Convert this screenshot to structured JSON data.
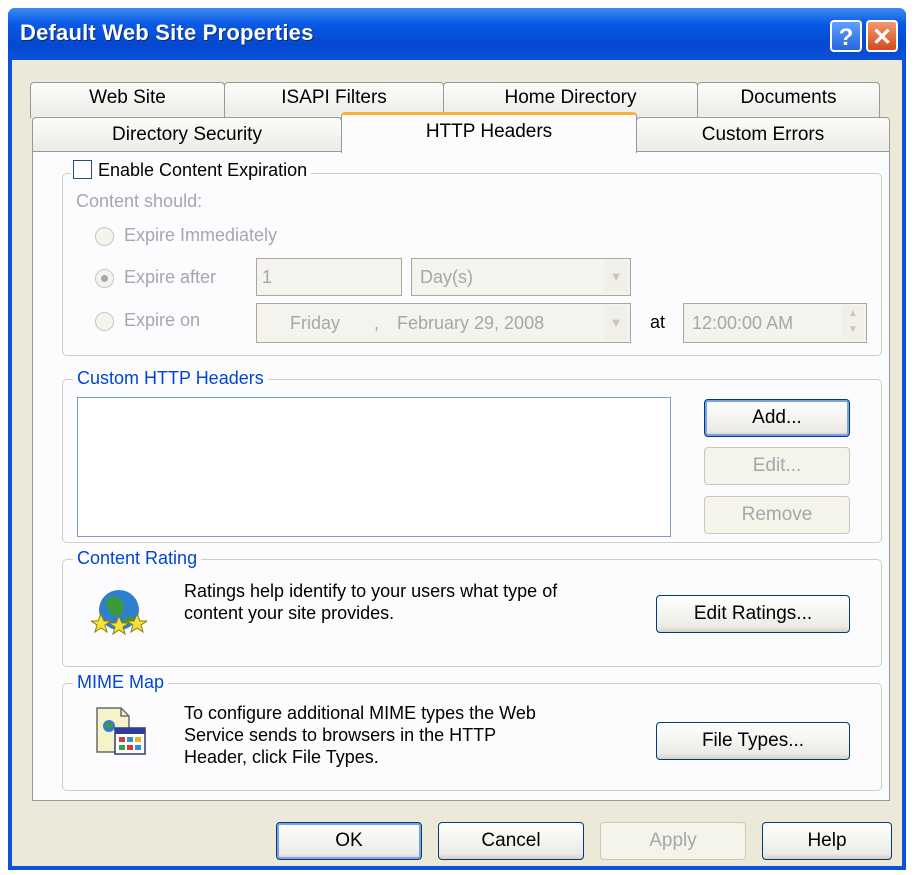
{
  "window": {
    "title": "Default Web Site Properties",
    "help_glyph": "?",
    "close_glyph": "✕"
  },
  "tabs_row1": [
    "Web Site",
    "ISAPI Filters",
    "Home Directory",
    "Documents"
  ],
  "tabs_row2": [
    "Directory Security",
    "HTTP Headers",
    "Custom Errors"
  ],
  "active_tab": "HTTP Headers",
  "expiration": {
    "checkbox_label": "Enable Content Expiration",
    "checked": false,
    "content_should": "Content should:",
    "radio_immediately": "Expire Immediately",
    "radio_after": "Expire after",
    "radio_on": "Expire on",
    "after_value": "1",
    "after_unit": "Day(s)",
    "date_weekday": "Friday",
    "date_sep": ",",
    "date_value": "February  29, 2008",
    "at_label": "at",
    "time_value": "12:00:00 AM"
  },
  "custom_headers": {
    "legend": "Custom HTTP Headers",
    "items": [],
    "add": "Add...",
    "edit": "Edit...",
    "remove": "Remove"
  },
  "content_rating": {
    "legend": "Content Rating",
    "line1": "Ratings help identify to your users what type of",
    "line2": "content your site provides.",
    "button": "Edit Ratings...",
    "icon": "ratings-globe-icon"
  },
  "mime_map": {
    "legend": "MIME Map",
    "line1": "To configure additional MIME types the Web",
    "line2": "Service sends to browsers in the HTTP",
    "line3": "Header, click File Types.",
    "button": "File Types...",
    "icon": "mime-document-icon"
  },
  "footer": {
    "ok": "OK",
    "cancel": "Cancel",
    "apply": "Apply",
    "help": "Help"
  },
  "colors": {
    "title_bar": "#0a52d8",
    "dialog_bg": "#ece9d8",
    "group_legend": "#0046d5",
    "active_tab_accent": "#f7b23b"
  }
}
